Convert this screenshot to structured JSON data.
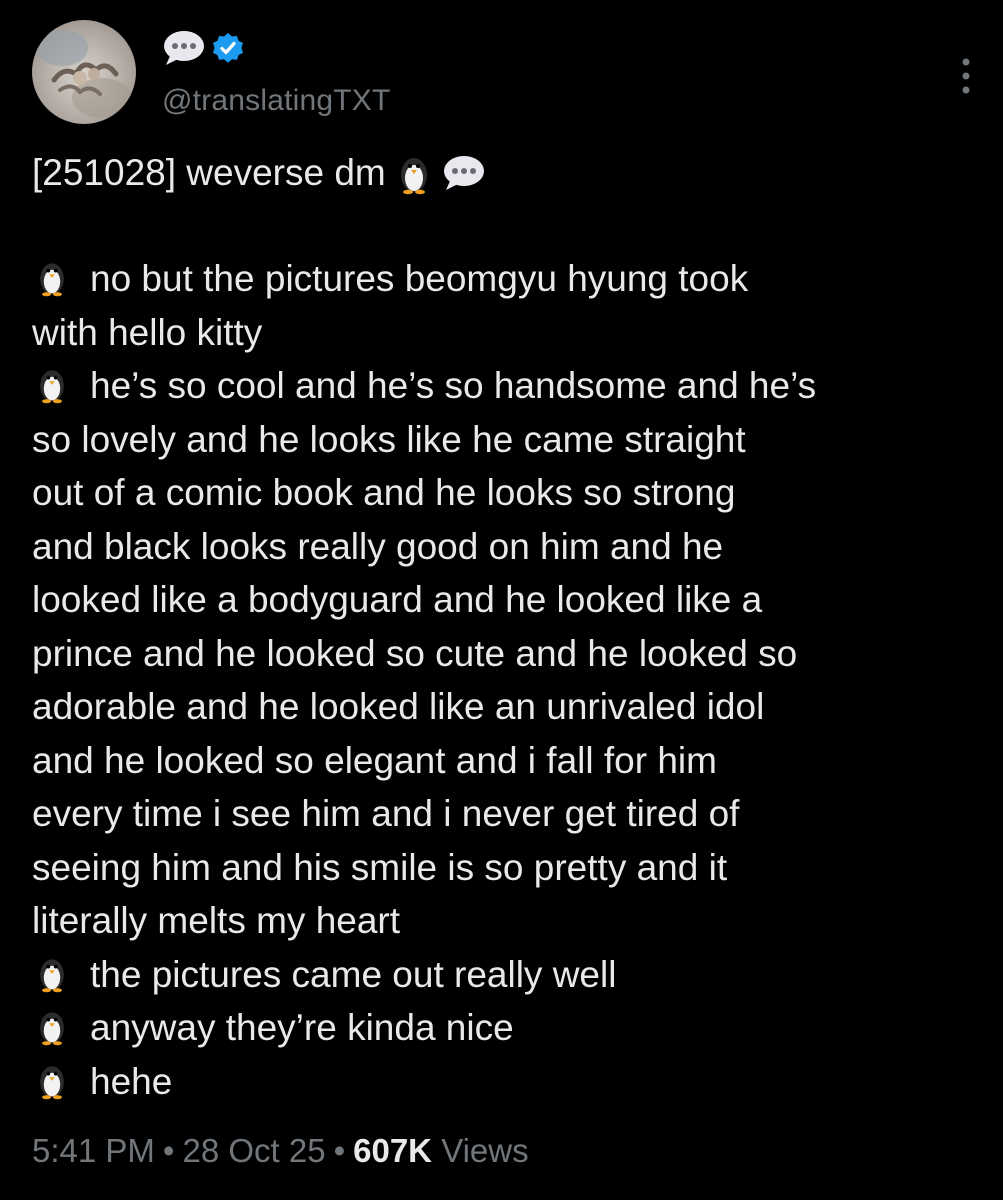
{
  "account": {
    "handle": "@translatingTXT",
    "name_icons": [
      "speech-bubble-icon",
      "verified-badge-icon"
    ],
    "verified_color": "#1d9bf0"
  },
  "tweet": {
    "title": "[251028] weverse dm",
    "title_icons": [
      "penguin-icon",
      "speech-bubble-icon"
    ],
    "paragraphs": [
      {
        "icon": "penguin-icon",
        "lines": [
          "no but the pictures beomgyu hyung took",
          "with hello kitty"
        ]
      },
      {
        "icon": "penguin-icon",
        "lines": [
          "he’s so cool and he’s so handsome and he’s",
          "so lovely and he looks like he came straight",
          "out of a comic book and he looks so strong",
          "and black looks really good on him and he",
          "looked like a bodyguard and he looked like a",
          "prince and he looked so cute and he looked so",
          "adorable and he looked like an unrivaled idol",
          "and he looked so elegant and i fall for him",
          "every time i see him and i never get tired of",
          "seeing him and his smile is so pretty and it",
          "literally melts my heart"
        ]
      },
      {
        "icon": "penguin-icon",
        "lines": [
          "the pictures came out really well"
        ]
      },
      {
        "icon": "penguin-icon",
        "lines": [
          "anyway they’re kinda nice"
        ]
      },
      {
        "icon": "penguin-icon",
        "lines": [
          "hehe"
        ]
      }
    ]
  },
  "meta": {
    "time": "5:41 PM",
    "separator": "•",
    "date": "28 Oct 25",
    "views_count": "607K",
    "views_label": "Views"
  },
  "colors": {
    "background": "#000000",
    "text": "#e7e9ea",
    "secondary": "#71767b"
  }
}
